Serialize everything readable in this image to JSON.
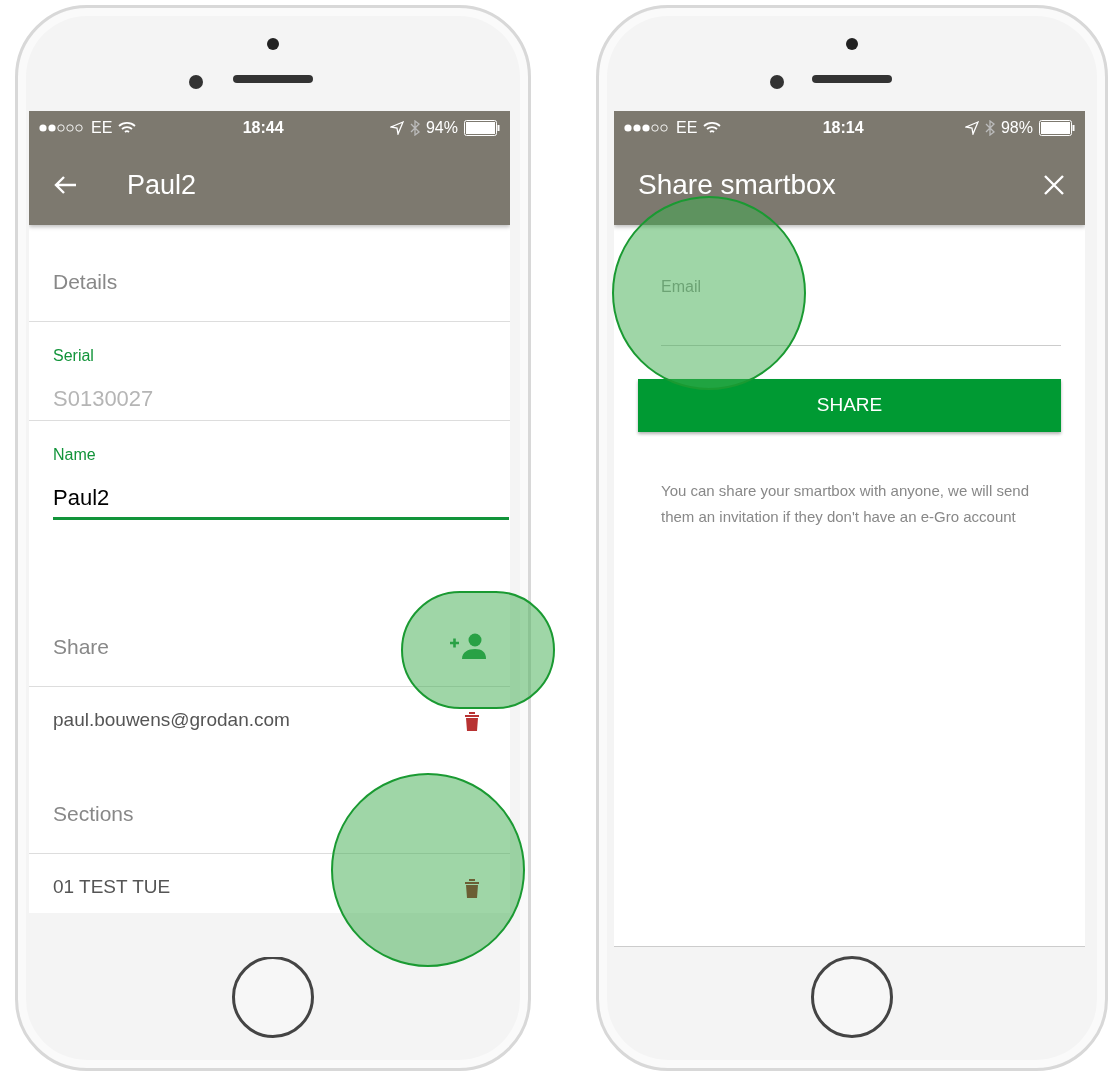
{
  "phones": [
    {
      "kind": "details",
      "status_bar": {
        "carrier": "EE",
        "time": "18:44",
        "battery": "94%"
      },
      "app_bar": {
        "title": "Paul2"
      },
      "details": {
        "header": "Details",
        "fields": [
          {
            "label": "Serial",
            "value": "S0130027",
            "disabled": true,
            "focused": false
          },
          {
            "label": "Name",
            "value": "Paul2",
            "disabled": false,
            "focused": true
          }
        ]
      },
      "share": {
        "header": "Share",
        "rows": [
          {
            "text": "paul.bouwens@grodan.com",
            "color": "#b83232"
          }
        ]
      },
      "sections": {
        "header": "Sections",
        "rows": [
          {
            "text": "01 TEST TUE",
            "color": "#6b5e34"
          }
        ]
      }
    },
    {
      "kind": "share",
      "status_bar": {
        "carrier": "EE",
        "time": "18:14",
        "battery": "98%"
      },
      "app_bar": {
        "title": "Share smartbox"
      },
      "email_field": {
        "placeholder": "Email"
      },
      "button": "SHARE",
      "note": "You can share your smartbox with anyone, we will send them an invitation if they don't have an e-Gro account"
    }
  ]
}
